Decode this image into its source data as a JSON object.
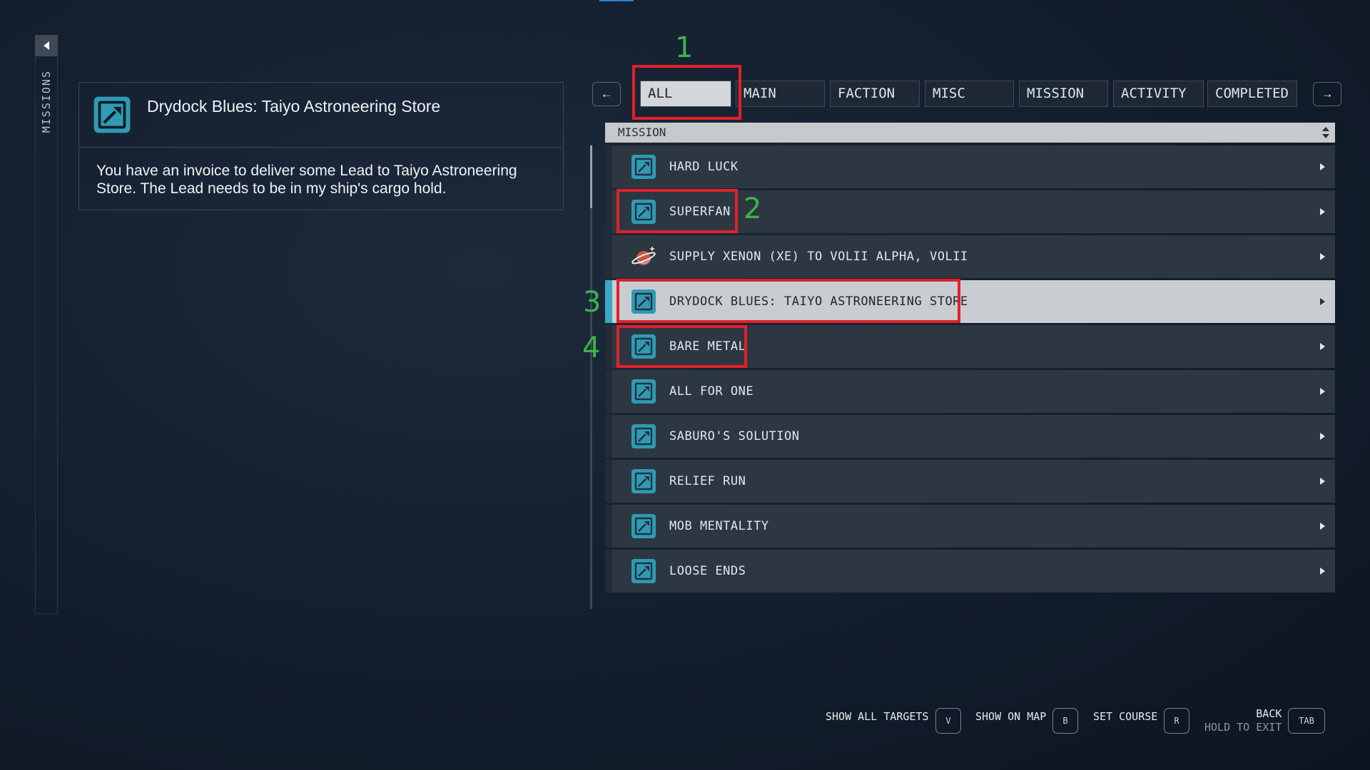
{
  "sidebar": {
    "label": "MISSIONS"
  },
  "detail": {
    "title": "Drydock Blues: Taiyo Astroneering Store",
    "description": "You have an invoice to deliver some Lead to Taiyo Astroneering Store. The Lead needs to be in my ship's cargo hold."
  },
  "tabs": {
    "prev": "←",
    "next": "→",
    "items": [
      "ALL",
      "MAIN",
      "FACTION",
      "MISC",
      "MISSION",
      "ACTIVITY",
      "COMPLETED"
    ],
    "active": "ALL"
  },
  "list": {
    "header": "MISSION",
    "items": [
      {
        "label": "HARD LUCK",
        "icon": "mission-icon"
      },
      {
        "label": "SUPERFAN",
        "icon": "mission-icon"
      },
      {
        "label": "SUPPLY XENON (XE) TO VOLII ALPHA, VOLII",
        "icon": "planet-icon"
      },
      {
        "label": "DRYDOCK BLUES: TAIYO ASTRONEERING STORE",
        "icon": "mission-icon",
        "selected": true
      },
      {
        "label": "BARE METAL",
        "icon": "mission-icon"
      },
      {
        "label": "ALL FOR ONE",
        "icon": "mission-icon"
      },
      {
        "label": "SABURO'S SOLUTION",
        "icon": "mission-icon"
      },
      {
        "label": "RELIEF RUN",
        "icon": "mission-icon"
      },
      {
        "label": "MOB MENTALITY",
        "icon": "mission-icon"
      },
      {
        "label": "LOOSE ENDS",
        "icon": "mission-icon"
      }
    ]
  },
  "annotations": [
    "1",
    "2",
    "3",
    "4"
  ],
  "footer": {
    "show_all_targets": "SHOW ALL TARGETS",
    "show_all_targets_key": "V",
    "show_on_map": "SHOW ON MAP",
    "show_on_map_key": "B",
    "set_course": "SET COURSE",
    "set_course_key": "R",
    "back": "BACK",
    "hold_to_exit": "HOLD TO EXIT",
    "back_key": "TAB"
  },
  "colors": {
    "accent": "#3aa9c4",
    "highlight": "#e3202a",
    "annotation": "#3cb44a"
  }
}
